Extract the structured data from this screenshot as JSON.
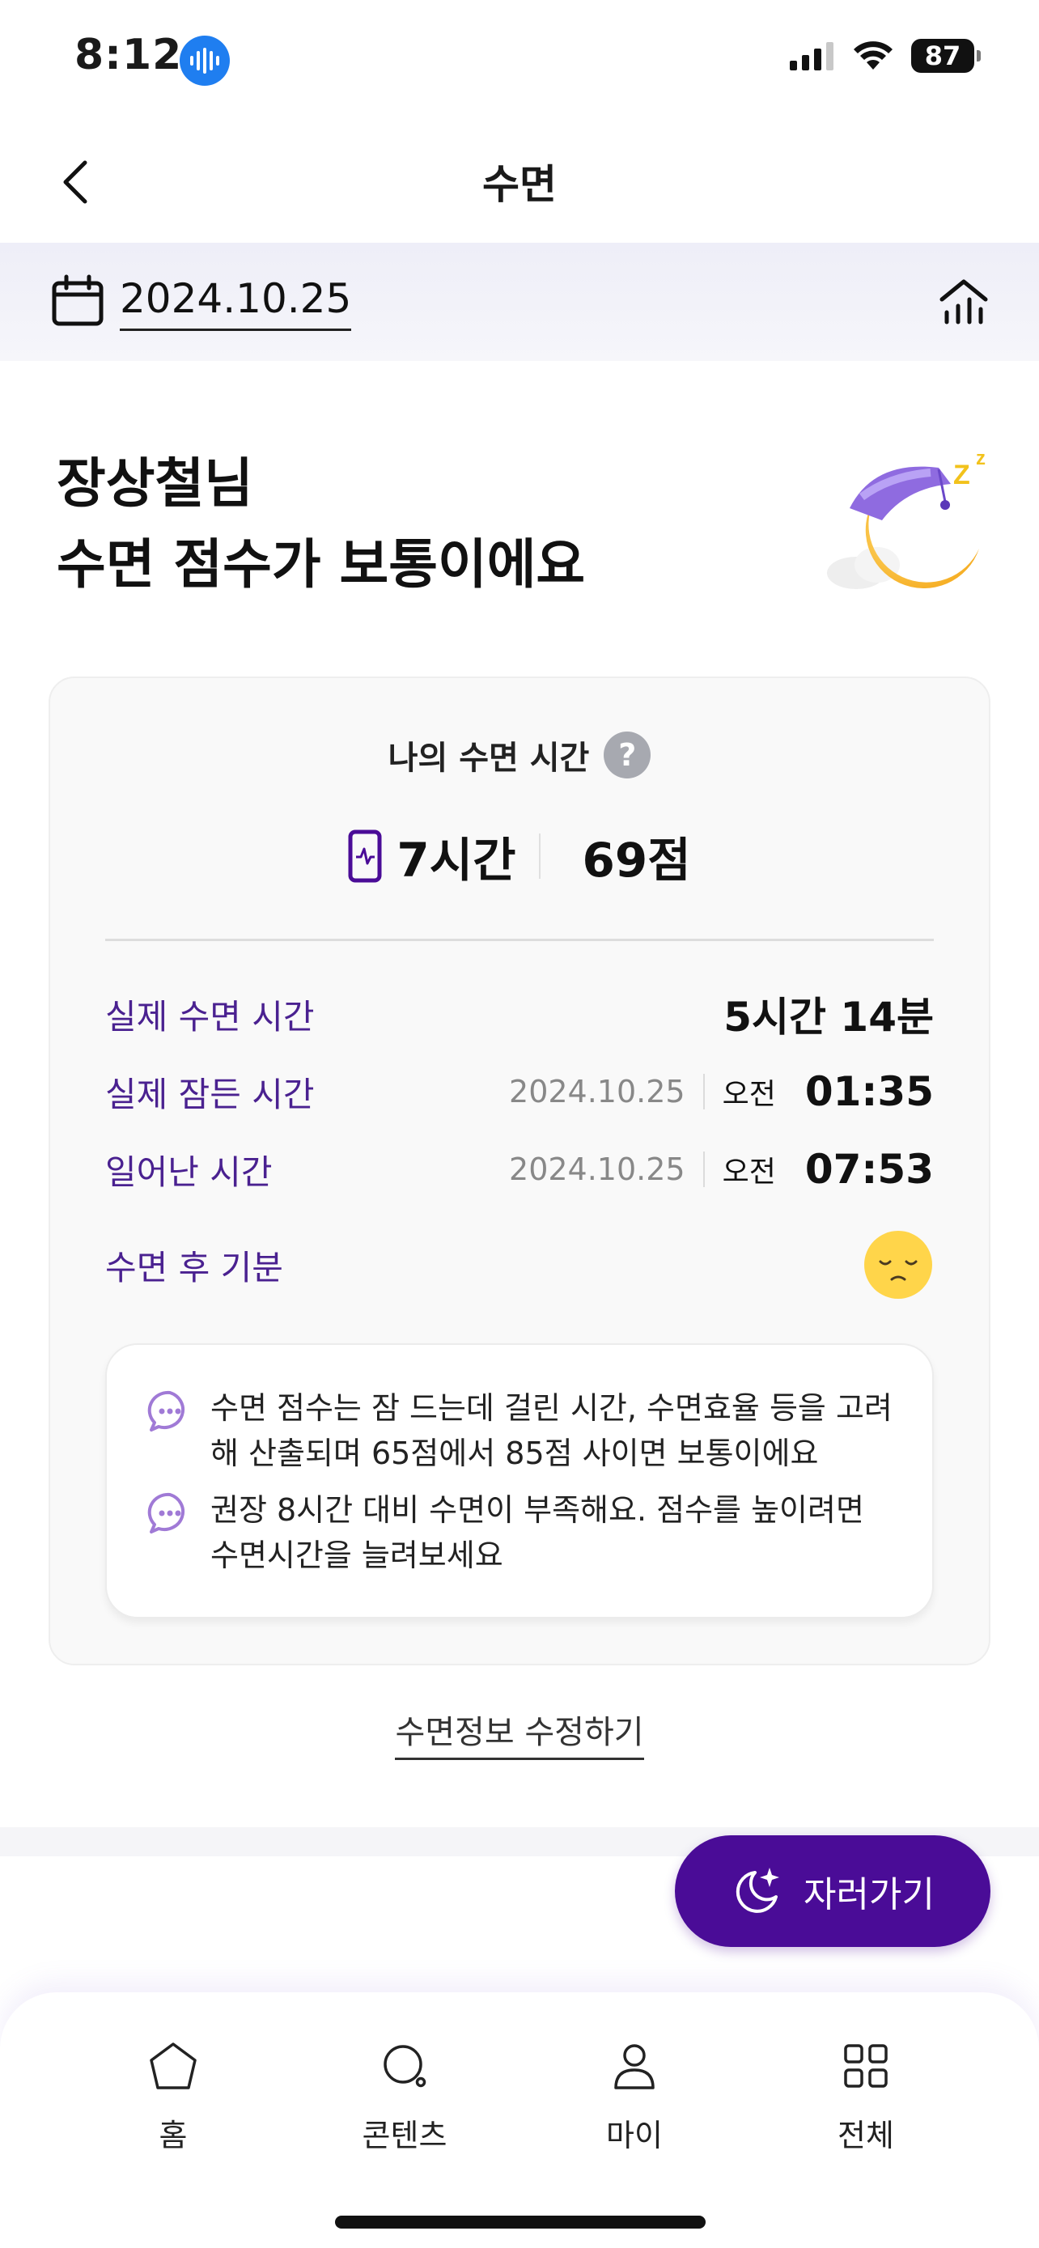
{
  "status_bar": {
    "time": "8:12",
    "battery": "87"
  },
  "header": {
    "title": "수면"
  },
  "date_bar": {
    "date": "2024.10.25"
  },
  "greeting": {
    "line1": "장상철님",
    "line2": "수면 점수가 보통이에요"
  },
  "card": {
    "title": "나의 수면 시간",
    "help": "?",
    "summary": {
      "hours": "7시간",
      "score": "69점"
    },
    "rows": {
      "actual_sleep": {
        "label": "실제 수면 시간",
        "value": "5시간 14분"
      },
      "fell_asleep": {
        "label": "실제 잠든 시간",
        "date": "2024.10.25",
        "ampm": "오전",
        "time": "01:35"
      },
      "woke_up": {
        "label": "일어난 시간",
        "date": "2024.10.25",
        "ampm": "오전",
        "time": "07:53"
      },
      "mood": {
        "label": "수면 후 기분"
      }
    },
    "tips": [
      {
        "text": "수면 점수는 잠 드는데 걸린 시간, 수면효율 등을 고려해 산출되며 65점에서 85점 사이면 보통이에요"
      },
      {
        "text": "권장 8시간 대비 수면이 부족해요. 점수를 높이려면 수면시간을 늘려보세요"
      }
    ]
  },
  "edit_link": "수면정보 수정하기",
  "sleep_button": {
    "label": "자러가기"
  },
  "bottom_nav": [
    {
      "label": "홈",
      "icon": "home-icon"
    },
    {
      "label": "콘텐츠",
      "icon": "content-search-icon"
    },
    {
      "label": "마이",
      "icon": "person-icon"
    },
    {
      "label": "전체",
      "icon": "grid-icon"
    }
  ],
  "colors": {
    "accent": "#4a0c97",
    "label_purple": "#4a2190",
    "voice_blue": "#1f7ef0"
  }
}
